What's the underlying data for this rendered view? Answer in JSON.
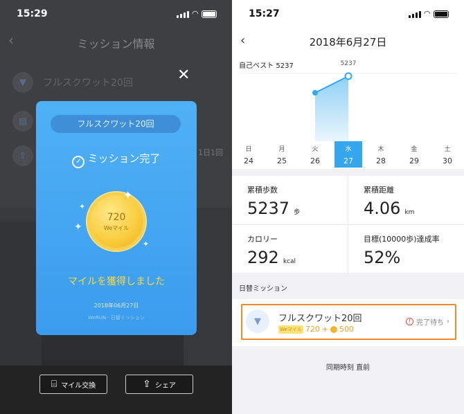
{
  "left": {
    "status_time": "15:29",
    "nav_title": "ミッション情報",
    "bg_items": [
      "フルスクワット20回",
      "",
      ""
    ],
    "bg_side_text": "1日1回",
    "popup": {
      "pill": "フルスクワット20回",
      "done": "ミッション完了",
      "coin_value": "720",
      "coin_unit": "Weマイル",
      "earned": "マイルを獲得しました",
      "date": "2018年06月27日",
      "source": "WeRUN · 日替ミッション"
    },
    "buttons": {
      "exchange": "マイル交換",
      "share": "シェア"
    }
  },
  "right": {
    "status_time": "15:27",
    "title": "2018年6月27日",
    "best_label": "自己ベスト 5237",
    "peak_label": "5237",
    "days": [
      {
        "w": "日",
        "d": "24"
      },
      {
        "w": "月",
        "d": "25"
      },
      {
        "w": "火",
        "d": "26"
      },
      {
        "w": "水",
        "d": "27"
      },
      {
        "w": "木",
        "d": "28"
      },
      {
        "w": "金",
        "d": "29"
      },
      {
        "w": "土",
        "d": "30"
      }
    ],
    "stats": [
      {
        "label": "累積歩数",
        "value": "5237",
        "unit": "歩"
      },
      {
        "label": "累積距離",
        "value": "4.06",
        "unit": "km"
      },
      {
        "label": "カロリー",
        "value": "292",
        "unit": "kcal"
      },
      {
        "label": "目標(10000歩)達成率",
        "value": "52%",
        "unit": ""
      }
    ],
    "section_title": "日替ミッション",
    "mission": {
      "name": "フルスクワット20回",
      "tag": "Weマイル",
      "reward_a": "720",
      "plus": "+",
      "reward_b": "500",
      "status": "完了待ち"
    },
    "sync_text": "同期時刻 直前"
  },
  "colors": {
    "accent": "#36a7ee",
    "highlight": "#ee8a2a",
    "reward": "#f2a12b"
  },
  "chart_data": {
    "type": "area",
    "categories": [
      "日24",
      "月25",
      "火26",
      "水27",
      "木28",
      "金29",
      "土30"
    ],
    "values": [
      null,
      null,
      3900,
      5237,
      null,
      null,
      null
    ]
  }
}
